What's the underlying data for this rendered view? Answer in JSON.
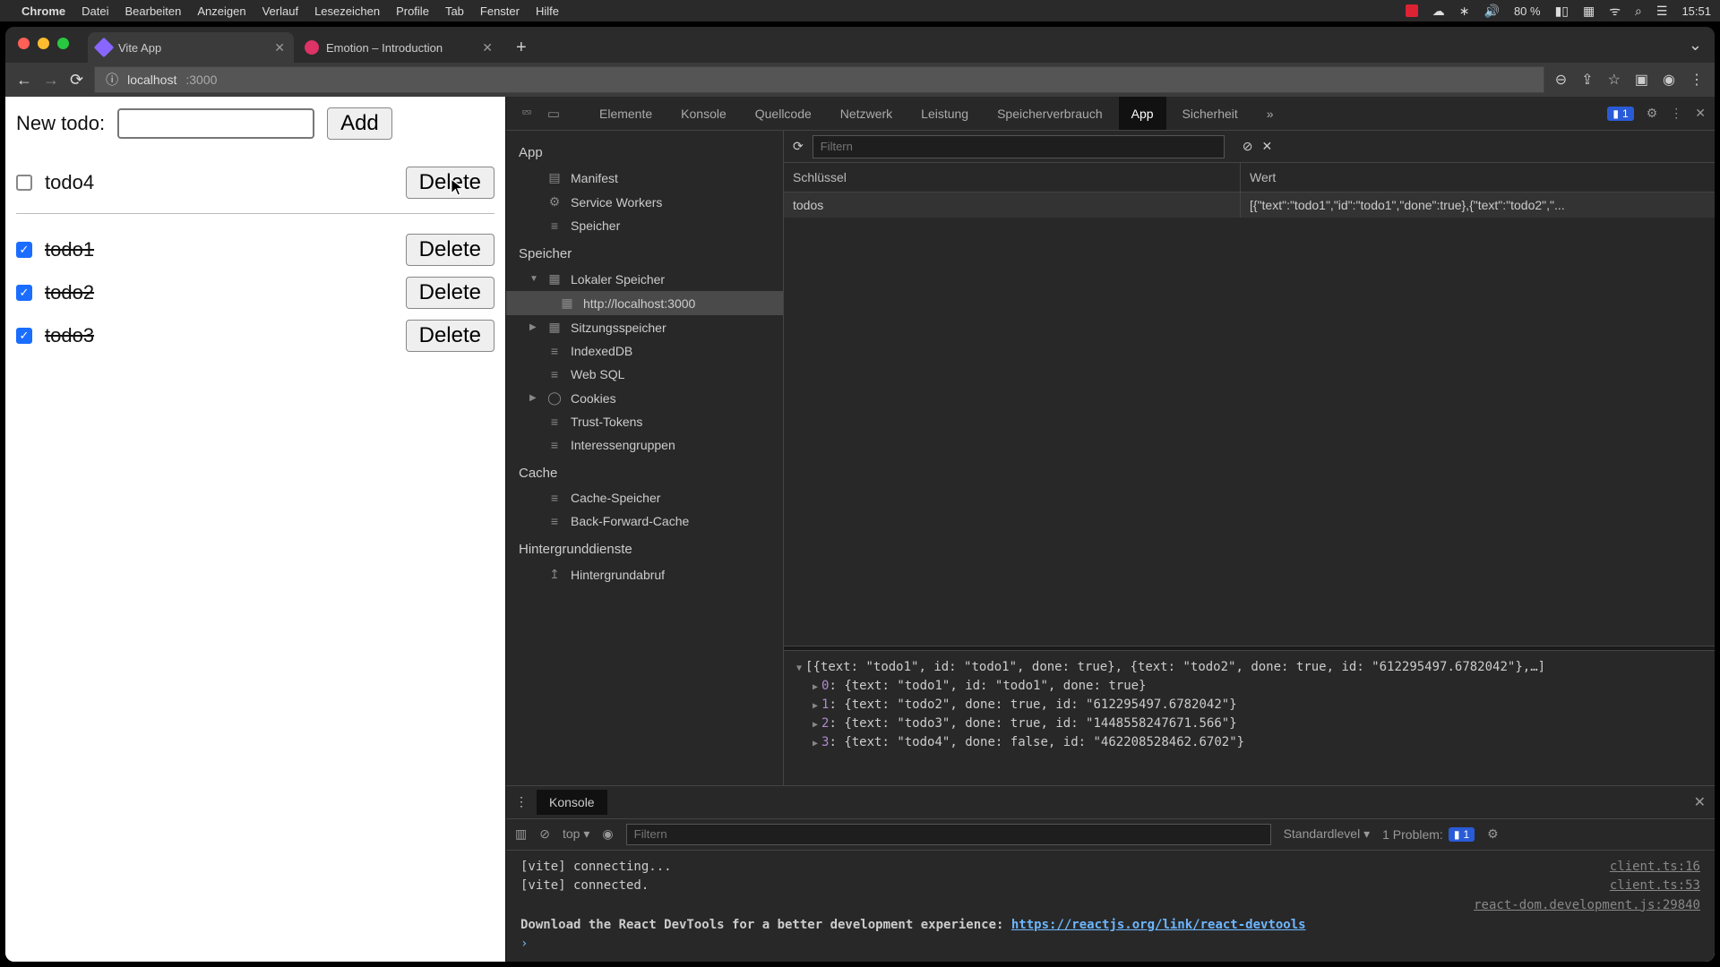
{
  "menubar": {
    "app": "Chrome",
    "items": [
      "Datei",
      "Bearbeiten",
      "Anzeigen",
      "Verlauf",
      "Lesezeichen",
      "Profile",
      "Tab",
      "Fenster",
      "Hilfe"
    ],
    "battery": "80 %",
    "clock": "15:51"
  },
  "tabs": [
    {
      "title": "Vite App"
    },
    {
      "title": "Emotion – Introduction"
    }
  ],
  "url_host": "localhost",
  "url_port": ":3000",
  "page": {
    "label": "New todo:",
    "add": "Add",
    "delete": "Delete",
    "todos_open": [
      {
        "text": "todo4",
        "done": false
      }
    ],
    "todos_done": [
      {
        "text": "todo1",
        "done": true
      },
      {
        "text": "todo2",
        "done": true
      },
      {
        "text": "todo3",
        "done": true
      }
    ]
  },
  "devtools": {
    "tabs": [
      "Elemente",
      "Konsole",
      "Quellcode",
      "Netzwerk",
      "Leistung",
      "Speicherverbrauch",
      "App",
      "Sicherheit"
    ],
    "active_tab": "App",
    "issues_count": "1",
    "filter_placeholder": "Filtern",
    "sidebar": {
      "app": "App",
      "manifest": "Manifest",
      "service_workers": "Service Workers",
      "speicher_app": "Speicher",
      "speicher": "Speicher",
      "local": "Lokaler Speicher",
      "local_origin": "http://localhost:3000",
      "session": "Sitzungsspeicher",
      "indexeddb": "IndexedDB",
      "websql": "Web SQL",
      "cookies": "Cookies",
      "trust": "Trust-Tokens",
      "interest": "Interessengruppen",
      "cache": "Cache",
      "cache_storage": "Cache-Speicher",
      "bfc": "Back-Forward-Cache",
      "bg": "Hintergrunddienste",
      "bgfetch": "Hintergrundabruf"
    },
    "table": {
      "key_header": "Schlüssel",
      "value_header": "Wert",
      "row_key": "todos",
      "row_value": "[{\"text\":\"todo1\",\"id\":\"todo1\",\"done\":true},{\"text\":\"todo2\",\"..."
    },
    "preview": {
      "summary": "[{text: \"todo1\", id: \"todo1\", done: true}, {text: \"todo2\", done: true, id: \"612295497.6782042\"},…]",
      "lines": [
        {
          "idx": "0",
          "body": "{text: \"todo1\", id: \"todo1\", done: true}"
        },
        {
          "idx": "1",
          "body": "{text: \"todo2\", done: true, id: \"612295497.6782042\"}"
        },
        {
          "idx": "2",
          "body": "{text: \"todo3\", done: true, id: \"1448558247671.566\"}"
        },
        {
          "idx": "3",
          "body": "{text: \"todo4\", done: false, id: \"462208528462.6702\"}"
        }
      ]
    }
  },
  "drawer": {
    "tab": "Konsole",
    "scope": "top",
    "filter_placeholder": "Filtern",
    "level": "Standardlevel",
    "problem_label": "1 Problem:",
    "problem_count": "1",
    "lines": [
      {
        "text": "[vite] connecting...",
        "src": "client.ts:16"
      },
      {
        "text": "[vite] connected.",
        "src": "client.ts:53"
      }
    ],
    "react_src": "react-dom.development.js:29840",
    "react_msg": "Download the React DevTools for a better development experience: ",
    "react_link": "https://reactjs.org/link/react-devtools"
  }
}
